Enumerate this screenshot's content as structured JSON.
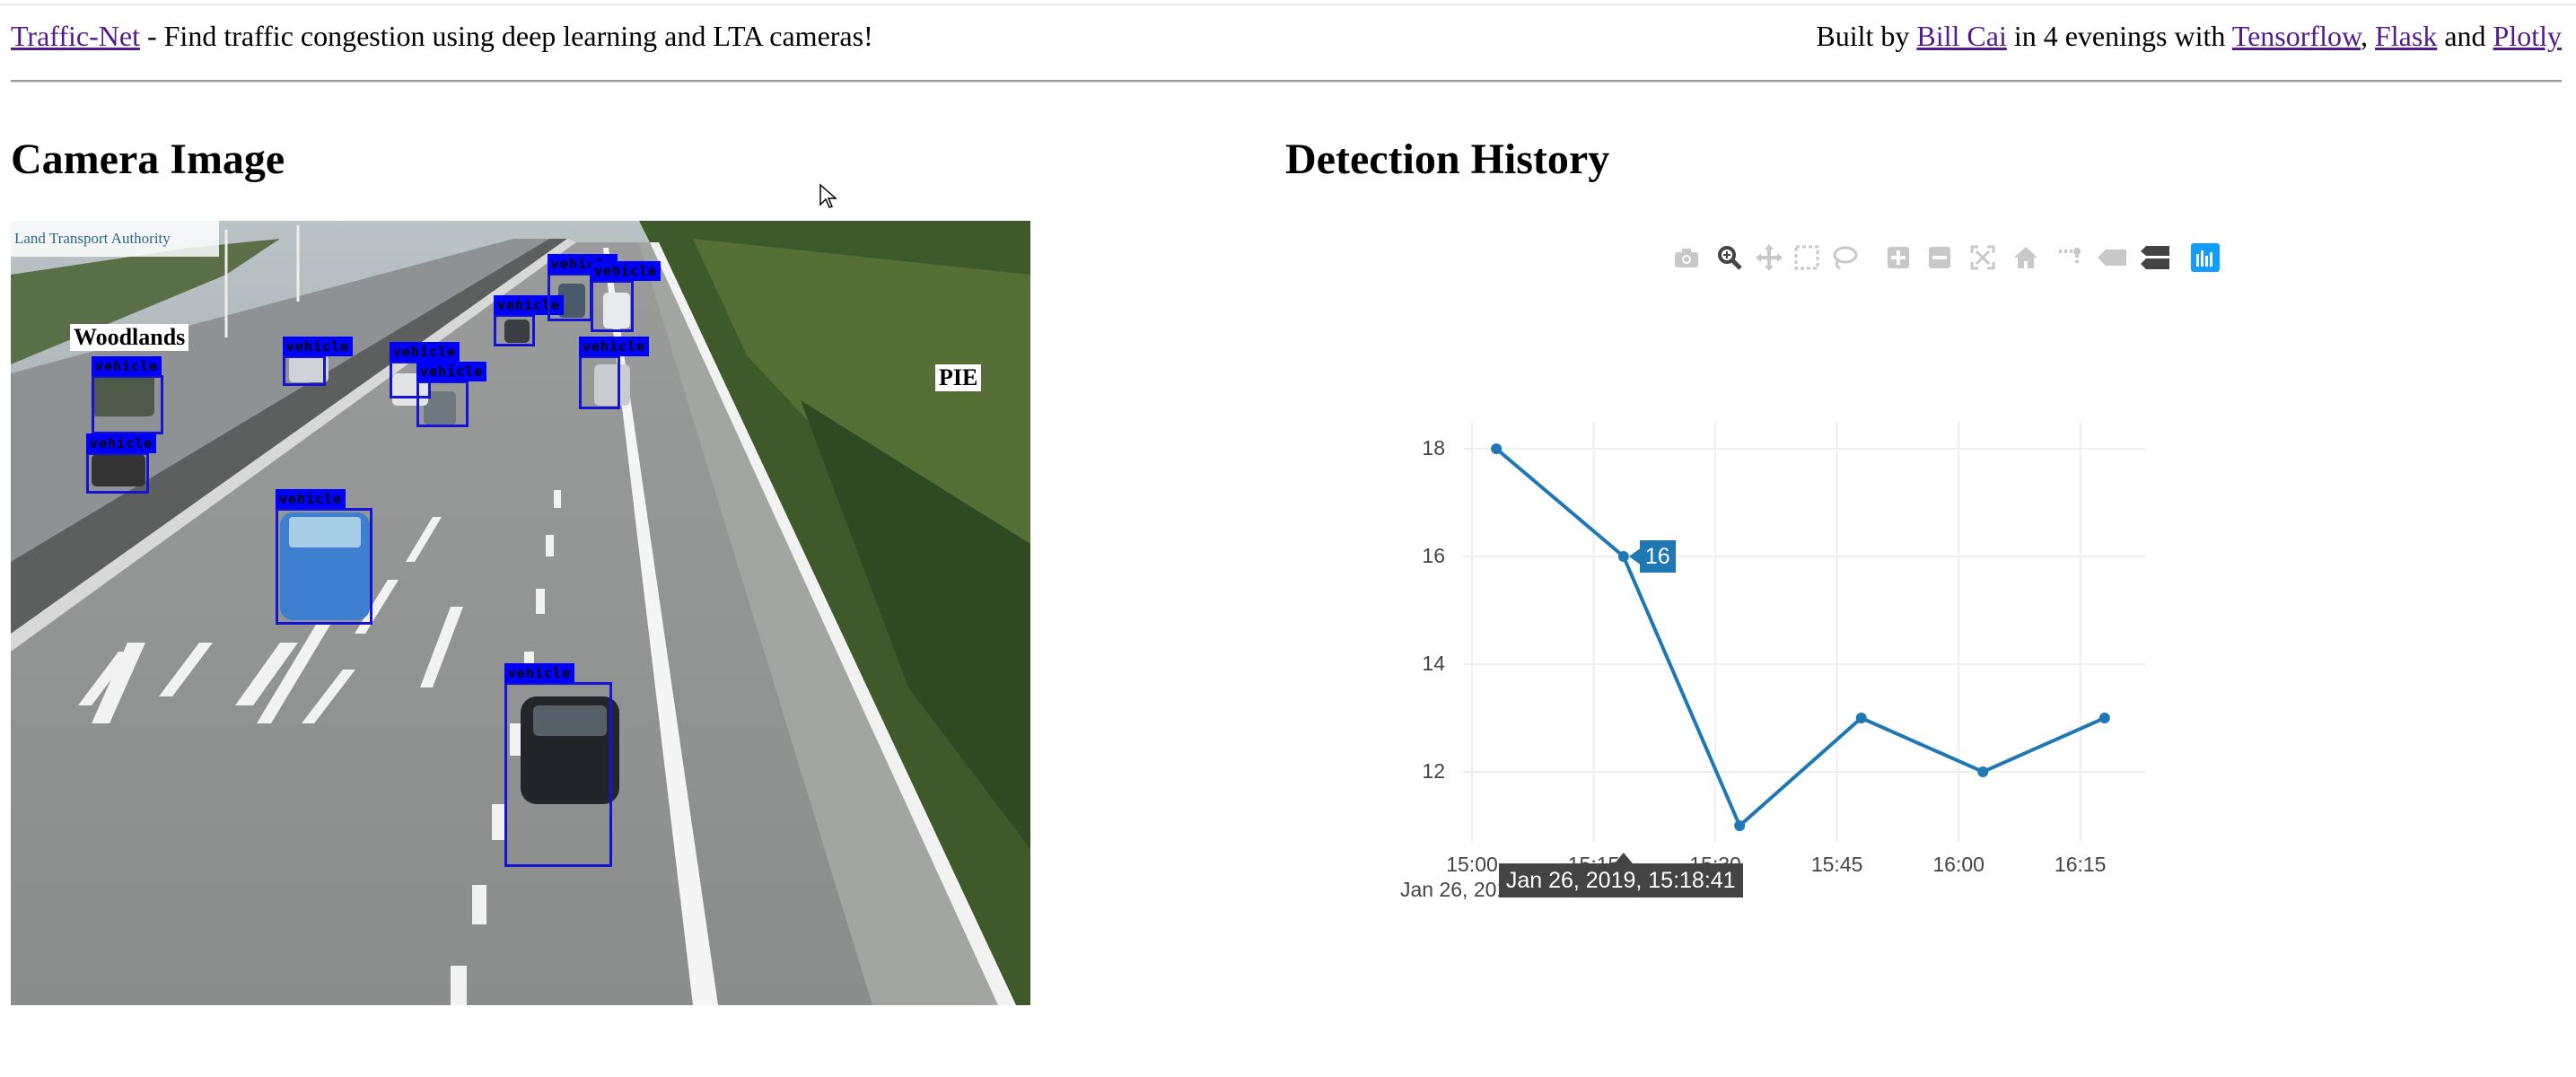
{
  "header": {
    "app_link": "Traffic-Net",
    "tagline": " - Find traffic congestion using deep learning and LTA cameras!",
    "built_by_prefix": "Built by ",
    "author_link": "Bill Cai",
    "built_mid": " in 4 evenings with ",
    "tech_links": [
      "Tensorflow",
      "Flask",
      "Plotly"
    ],
    "sep_comma": ", ",
    "sep_and": " and "
  },
  "camera": {
    "title": "Camera Image",
    "logo_text": "Land Transport Authority",
    "signs": [
      "Woodlands",
      "PIE"
    ],
    "detection_label": "vehicle"
  },
  "history": {
    "title": "Detection History",
    "modebar_icons": [
      "camera-icon",
      "zoom-icon",
      "pan-icon",
      "box-select-icon",
      "lasso-select-icon",
      "zoom-in-icon",
      "zoom-out-icon",
      "autoscale-icon",
      "reset-axes-icon",
      "spike-lines-icon",
      "hover-closest-icon",
      "hover-compare-icon",
      "plotly-logo-icon"
    ],
    "hover_value": "16",
    "hover_x": "Jan 26, 2019, 15:18:41",
    "x_date_label": "Jan 26, 2019",
    "colors": {
      "line": "#1f77b4",
      "grid": "#eeeeee",
      "hover_x_bg": "#444444",
      "plotly_logo": "#119dff"
    }
  },
  "chart_data": {
    "type": "line",
    "x": [
      "2019-01-26 15:03",
      "2019-01-26 15:18:41",
      "2019-01-26 15:33",
      "2019-01-26 15:48",
      "2019-01-26 16:03",
      "2019-01-26 16:18"
    ],
    "series": [
      {
        "values": [
          18,
          16,
          11,
          13,
          12,
          13
        ]
      }
    ],
    "x_ticks": [
      "15:00",
      "15:15",
      "15:30",
      "15:45",
      "16:00",
      "16:15"
    ],
    "y_ticks": [
      "12",
      "14",
      "16",
      "18"
    ],
    "ylim": [
      10.7,
      18.5
    ],
    "grid": true
  }
}
